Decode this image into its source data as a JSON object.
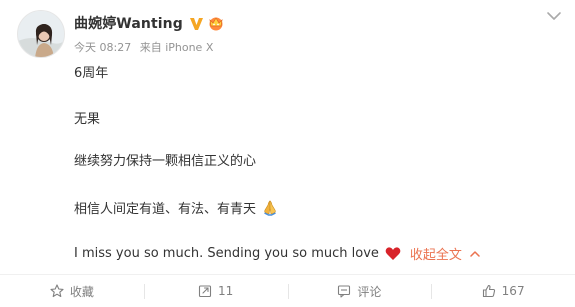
{
  "post": {
    "author_name": "曲婉婷Wanting",
    "time": "今天 08:27",
    "source": "来自 iPhone X",
    "paragraphs": [
      "6周年",
      "无果",
      "继续努力保持一颗相信正义的心",
      "相信人间定有道、有法、有青天",
      "I miss you so much. Sending you so much love"
    ],
    "collapse_label": "收起全文",
    "icons": {
      "verified": "verified-v-icon",
      "member": "member-crown-icon",
      "pray": "folded-hands-emoji",
      "heart": "red-heart-emoji",
      "more": "chevron-down-icon"
    },
    "colors": {
      "accent": "#eb7350",
      "verified": "#f5a623",
      "heart": "#d8232a"
    }
  },
  "actions": {
    "favorite_label": "收藏",
    "repost_count": "11",
    "comment_label": "评论",
    "like_count": "167"
  }
}
